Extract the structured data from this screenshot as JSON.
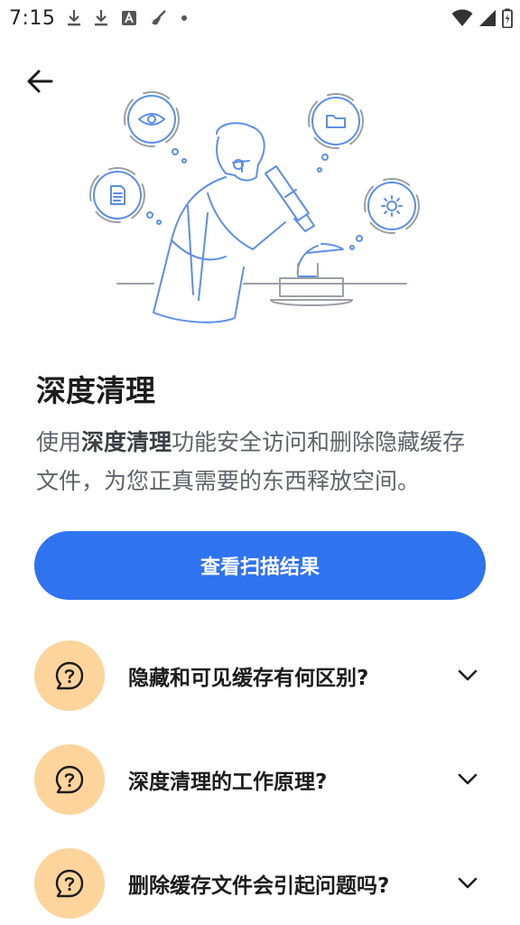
{
  "status_bar": {
    "time": "7:15",
    "left_icons": [
      "download-icon",
      "download-icon",
      "app-a-icon",
      "broom-icon",
      "dot-icon"
    ],
    "right_icons": [
      "wifi-icon",
      "signal-icon",
      "battery-icon"
    ]
  },
  "header": {
    "back_icon": "arrow-left-icon"
  },
  "illustration": {
    "subject": "scientist-microscope",
    "bubble_icons": [
      "eye-icon",
      "folder-icon",
      "document-icon",
      "gear-icon"
    ]
  },
  "main": {
    "title": "深度清理",
    "description_prefix": "使用",
    "description_bold": "深度清理",
    "description_suffix": "功能安全访问和删除隐藏缓存文件，为您正真需要的东西释放空间。",
    "primary_button_label": "查看扫描结果"
  },
  "faq": {
    "items": [
      {
        "question": "隐藏和可见缓存有何区别?"
      },
      {
        "question": "深度清理的工作原理?"
      },
      {
        "question": "删除缓存文件会引起问题吗?"
      }
    ]
  },
  "colors": {
    "primary": "#2f73f0",
    "faq_icon_bg": "#fcd49c",
    "illustration_stroke": "#5b8fe8",
    "title_text": "#1c1c1c",
    "body_text": "#5f6368"
  }
}
